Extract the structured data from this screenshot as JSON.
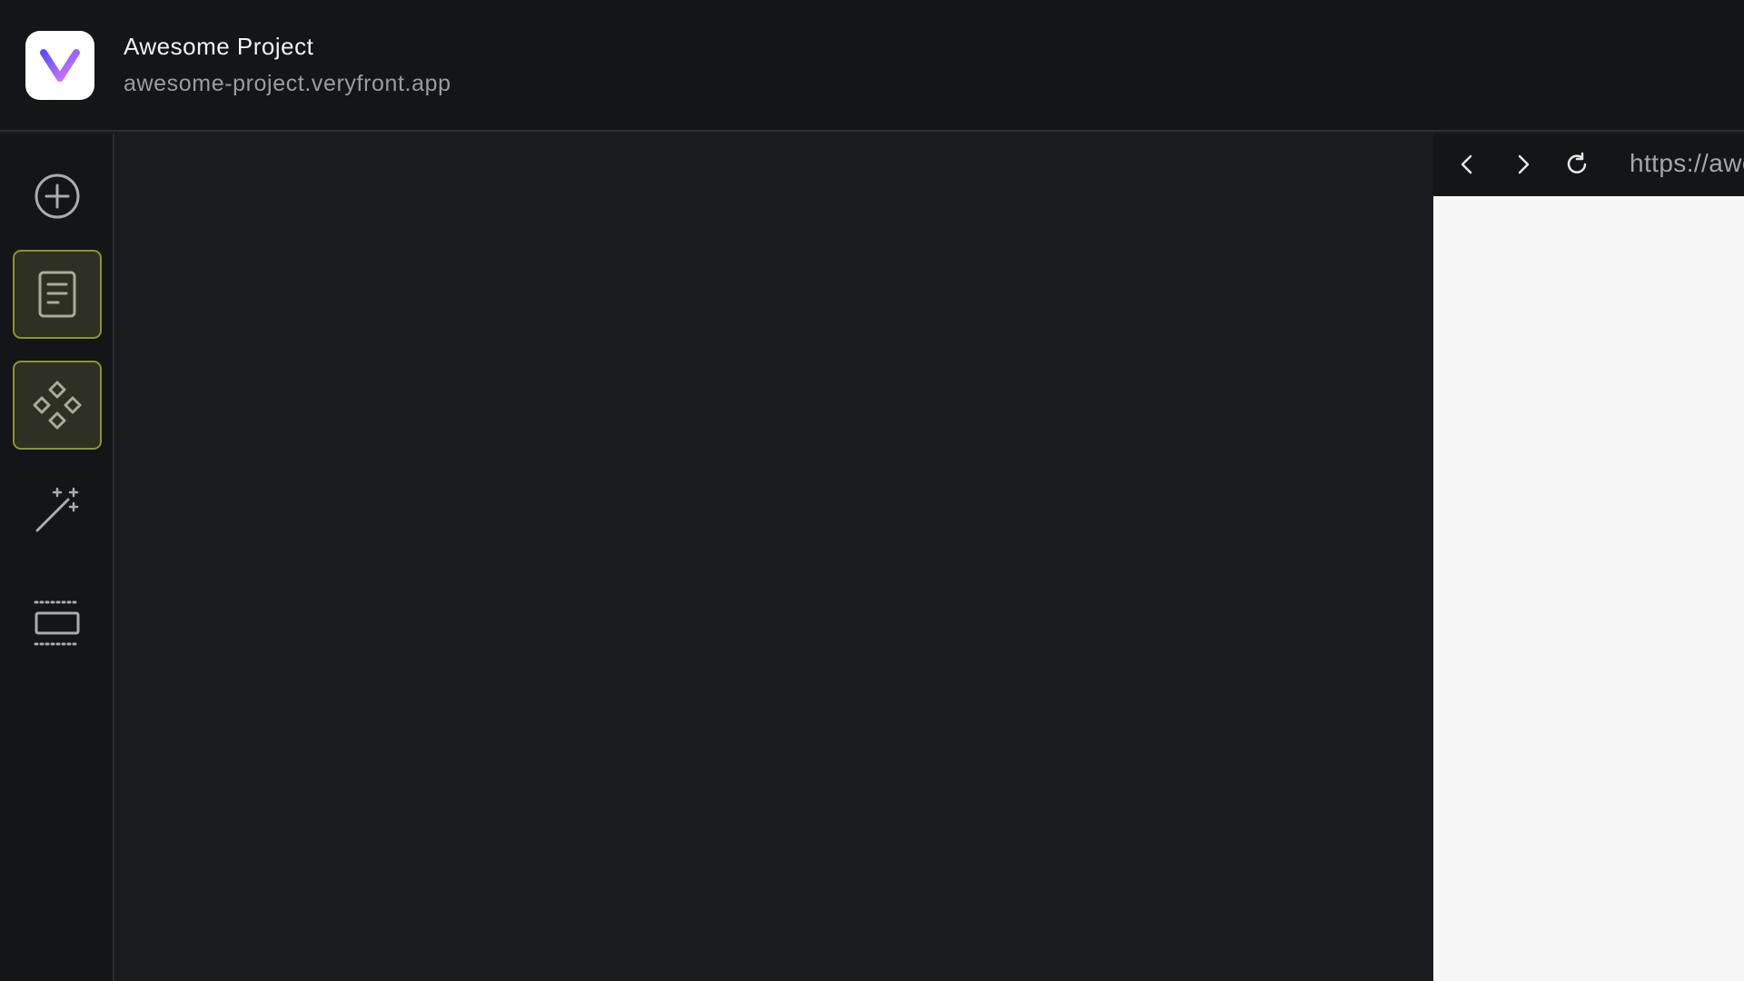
{
  "header": {
    "project_name": "Awesome Project",
    "project_url": "awesome-project.veryfront.app",
    "logo_icon": "veryfront-logo-icon"
  },
  "sidebar": {
    "items": [
      {
        "name": "add",
        "icon": "plus-circle-icon",
        "active": false
      },
      {
        "name": "pages",
        "icon": "document-icon",
        "active": true
      },
      {
        "name": "components",
        "icon": "components-icon",
        "active": true
      },
      {
        "name": "ai",
        "icon": "magic-wand-icon",
        "active": false
      },
      {
        "name": "sections",
        "icon": "section-layout-icon",
        "active": false
      }
    ]
  },
  "preview": {
    "url": "https://awesome-project.veryfront.app",
    "back_icon": "chevron-left-icon",
    "forward_icon": "chevron-right-icon",
    "reload_icon": "reload-icon"
  },
  "colors": {
    "active_border": "#8a962b",
    "active_bg": "#2e3023",
    "logo_gradient_start": "#7c4dff",
    "logo_gradient_end": "#d06bff"
  }
}
